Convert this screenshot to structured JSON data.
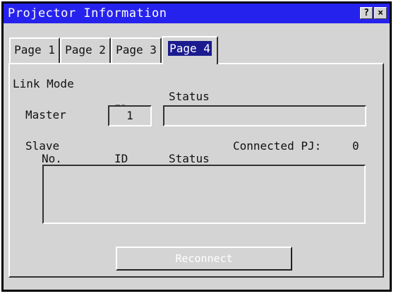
{
  "window": {
    "title": "Projector Information",
    "help_label": "?",
    "close_label": "×"
  },
  "tabs": [
    {
      "label": "Page 1"
    },
    {
      "label": "Page 2"
    },
    {
      "label": "Page 3"
    },
    {
      "label": "Page 4",
      "active": true
    }
  ],
  "link_mode": {
    "heading": "Link Mode",
    "id_header": "ID",
    "status_header": "Status",
    "master_label": "Master",
    "master_id": "1",
    "master_status": "",
    "slave_label": "Slave",
    "connected_label": "Connected PJ:",
    "connected_count": "0",
    "col_no": "No.",
    "col_id": "ID",
    "col_status": "Status",
    "reconnect_label": "Reconnect"
  },
  "colors": {
    "titlebar": "#2622ee",
    "active_tab_highlight": "#1b1b8f",
    "face": "#d4d4d4"
  }
}
